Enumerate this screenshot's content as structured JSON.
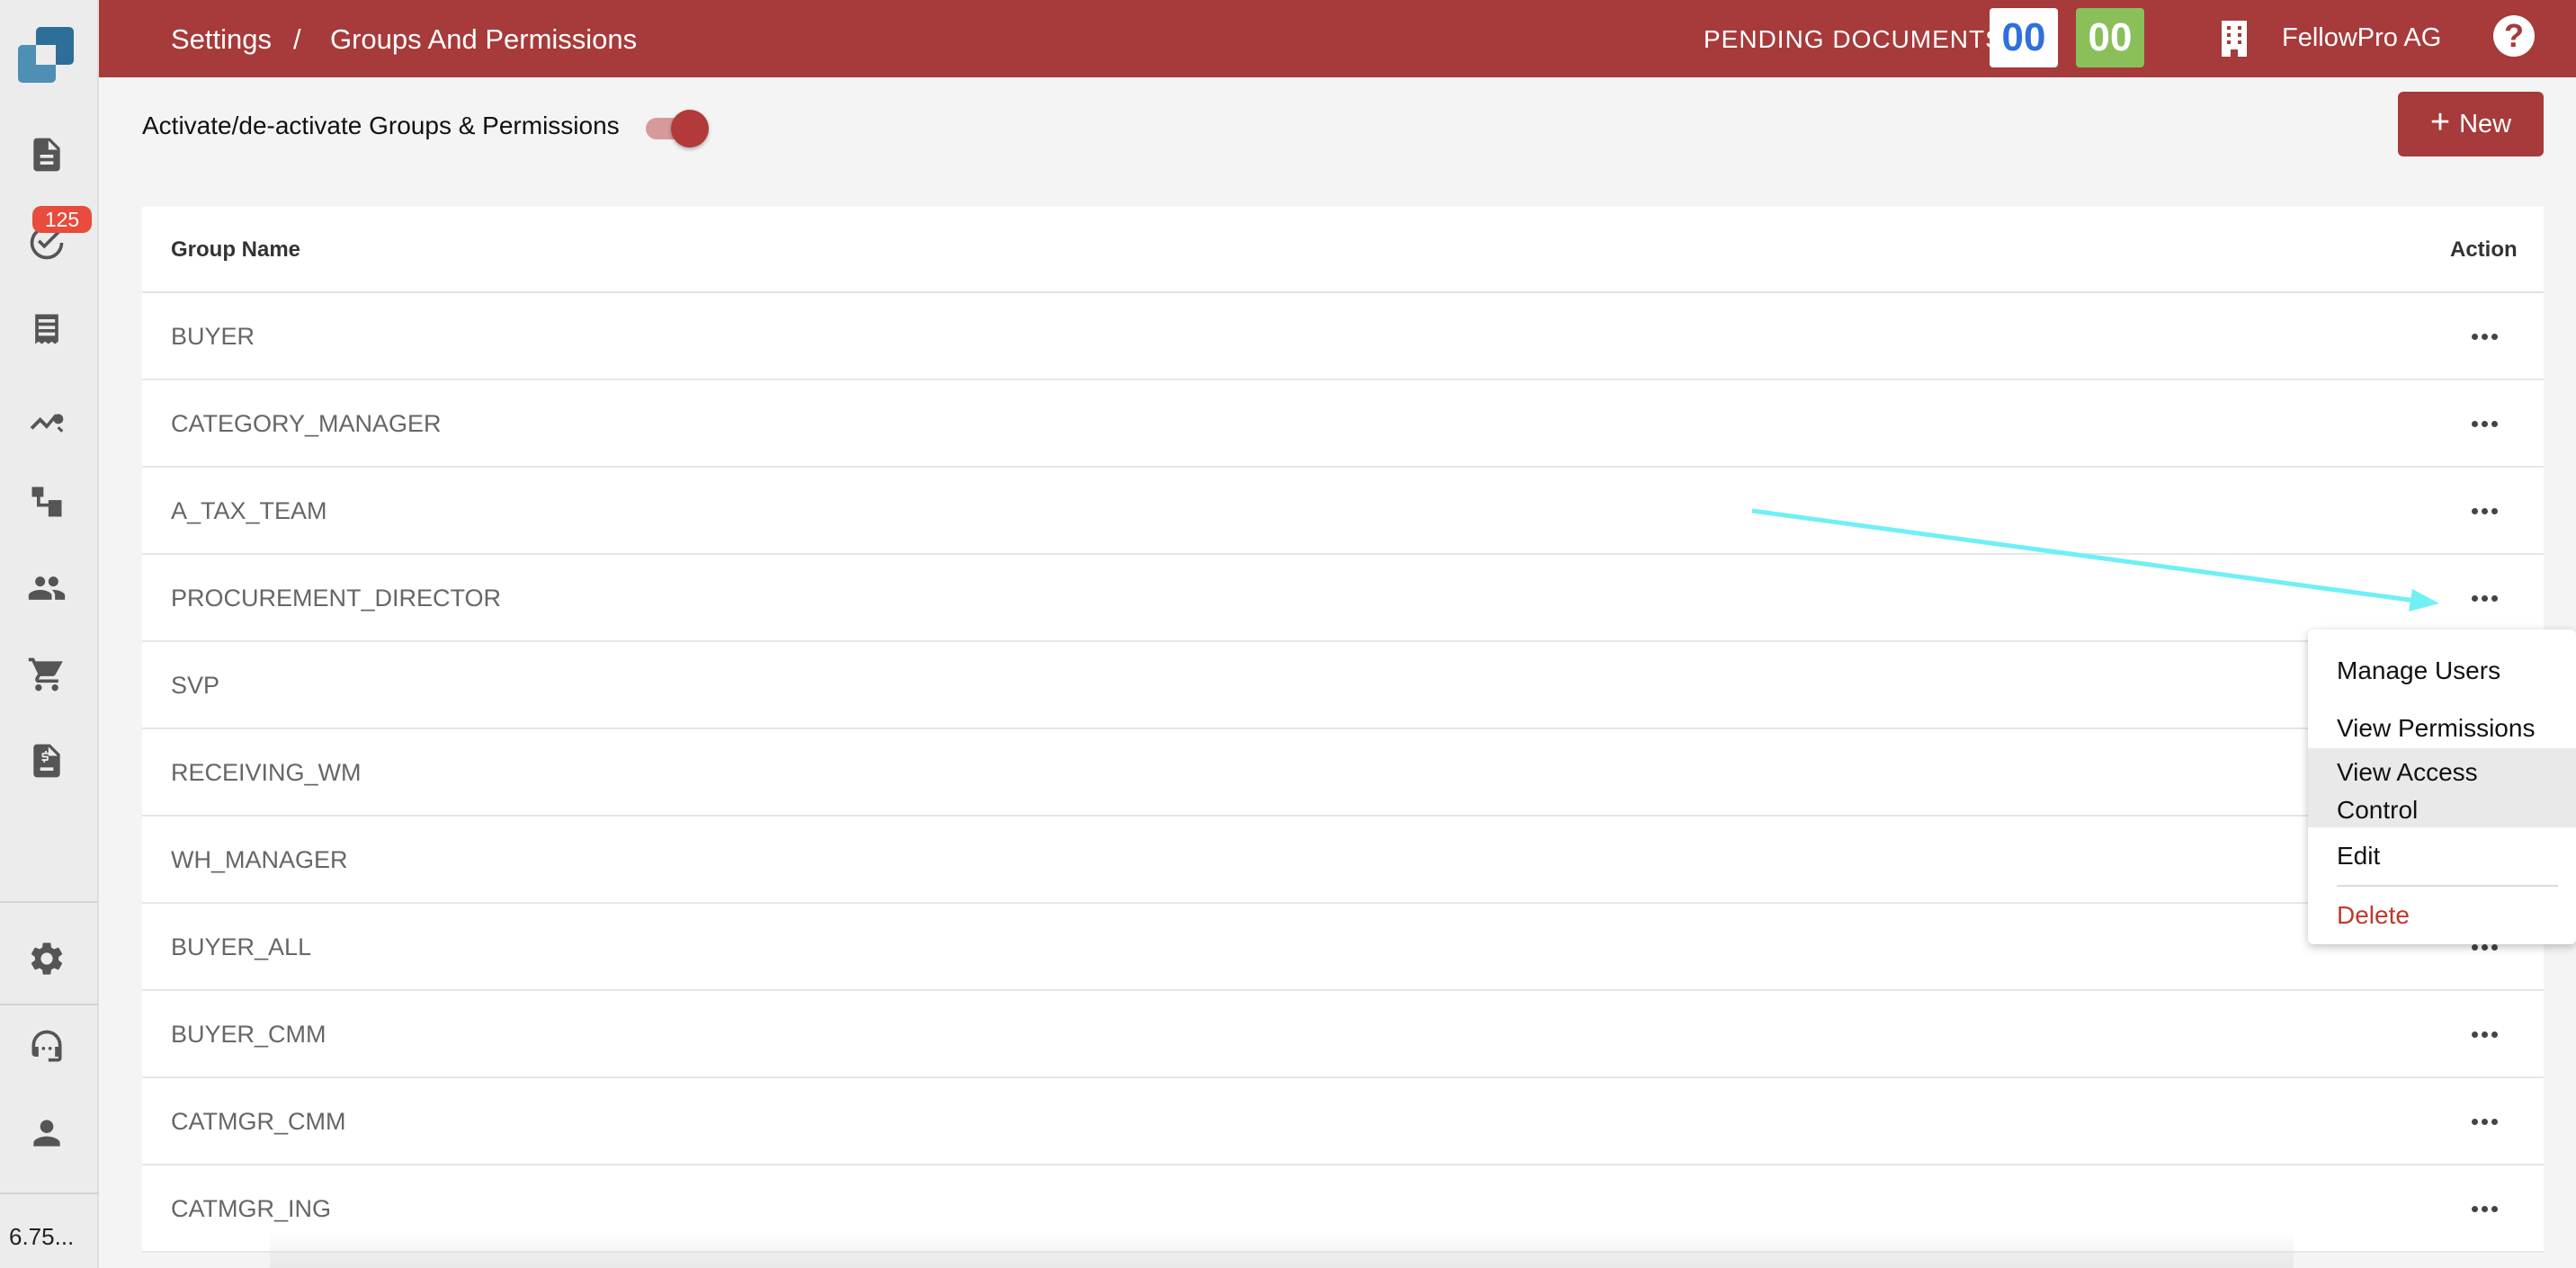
{
  "sidebar": {
    "tasks_badge": "125",
    "version": "6.75...",
    "items": [
      {
        "icon": "document-icon"
      },
      {
        "icon": "tasks-check-icon"
      },
      {
        "icon": "receipt-icon"
      },
      {
        "icon": "analytics-search-icon"
      },
      {
        "icon": "hierarchy-icon"
      },
      {
        "icon": "people-icon"
      },
      {
        "icon": "cart-icon"
      },
      {
        "icon": "invoice-icon"
      },
      {
        "icon": "gear-icon"
      },
      {
        "icon": "support-agent-icon"
      },
      {
        "icon": "user-icon"
      }
    ]
  },
  "header": {
    "breadcrumb_root": "Settings",
    "breadcrumb_sep": "/",
    "breadcrumb_current": "Groups And Permissions",
    "pending_label": "PENDING DOCUMENTS:",
    "pending_blue": "00",
    "pending_green": "00",
    "company": "FellowPro AG",
    "help": "?"
  },
  "toolbar": {
    "toggle_label": "Activate/de-activate Groups & Permissions",
    "toggle_on": true,
    "new_label": "New"
  },
  "table": {
    "columns": [
      "Group Name",
      "Action"
    ],
    "rows": [
      "BUYER",
      "CATEGORY_MANAGER",
      "A_TAX_TEAM",
      "PROCUREMENT_DIRECTOR",
      "SVP",
      "RECEIVING_WM",
      "WH_MANAGER",
      "BUYER_ALL",
      "BUYER_CMM",
      "CATMGR_CMM",
      "CATMGR_ING"
    ]
  },
  "action_menu": {
    "items": [
      "Manage Users",
      "View Permissions",
      "View Access",
      "Control",
      "Edit",
      "Delete"
    ]
  },
  "colors": {
    "brand": "#a73a3a",
    "pending_blue": "#2f6fde",
    "pending_green": "#8bbf5a",
    "badge": "#e74c3c",
    "delete": "#c0392b",
    "annotation_arrow": "#6ff0f5"
  }
}
